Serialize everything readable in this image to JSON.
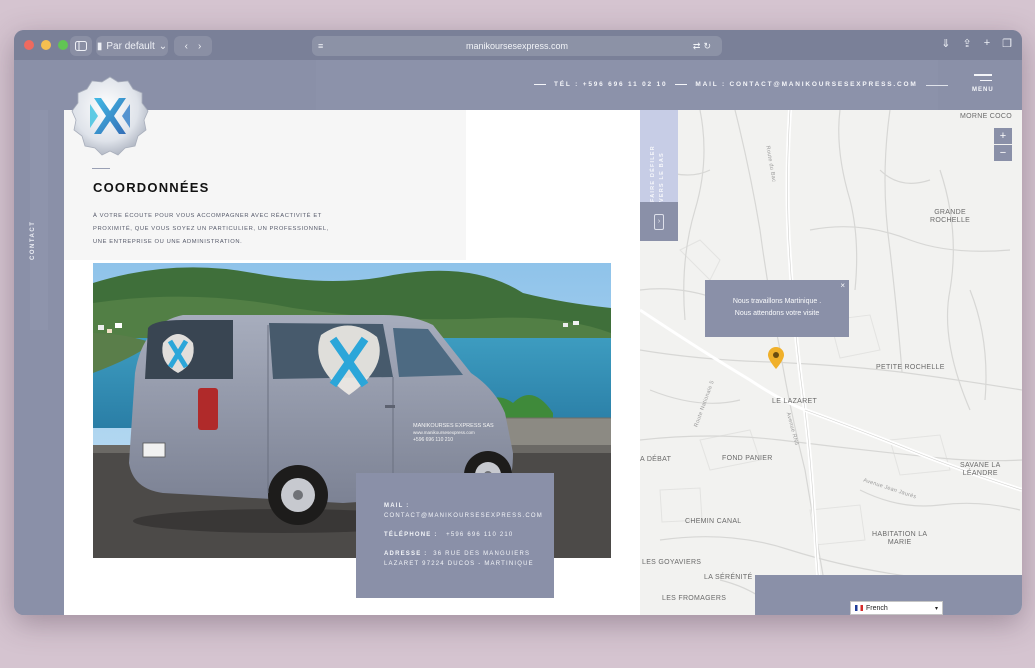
{
  "browser": {
    "profile": "Par default",
    "url": "manikoursesexpress.com"
  },
  "header": {
    "phone": "TÉL : +596 696 11 02 10",
    "mail": "MAIL : CONTACT@MANIKOURSESEXPRESS.COM",
    "menu_label": "MENU"
  },
  "sidebar": {
    "label": "CONTACT"
  },
  "contact_page": {
    "title": "COORDONNÉES",
    "intro": "À votre écoute pour vous accompagner avec réactivité et proximité, que vous soyez un particulier, un professionnel, une entreprise ou une administration.",
    "van_text_1": "MANIKOURSES EXPRESS SAS",
    "van_text_2": "www.manikoursesexpress.com",
    "van_text_3": "+596 696 110 210",
    "info": {
      "mail_label": "MAIL :",
      "mail_value": "CONTACT@MANIKOURSESEXPRESS.COM",
      "phone_label": "TÉLÉPHONE :",
      "phone_value": "+596 696 110 210",
      "address_label": "ADRESSE :",
      "address_value": "36 RUE DES MANGUIERS",
      "address_value_2": "LAZARET 97224 DUCOS - MARTINIQUE"
    }
  },
  "map": {
    "scroll_label": "FAIRE DÉFILER VERS LE BAS",
    "arrow": "›",
    "zoom_in": "+",
    "zoom_out": "−",
    "popup_line1": "Nous travaillons Martinique .",
    "popup_line2": "Nous attendons votre visite",
    "popup_close": "×",
    "places": {
      "morne_coco": "MORNE COCO",
      "grande_rochelle_1": "GRANDE",
      "grande_rochelle_2": "ROCHELLE",
      "petite_rochelle": "PETITE ROCHELLE",
      "le_lazaret": "LE LAZARET",
      "debat": "A DÉBAT",
      "fond_panier": "FOND PANIER",
      "savane_1": "SAVANE LA",
      "savane_2": "LÉANDRE",
      "chemin_canal": "CHEMIN CANAL",
      "les_goyaviers": "LES GOYAVIERS",
      "la_serenite": "LA SÉRÉNITÉ",
      "habitation_1": "HABITATION LA",
      "habitation_2": "MARIE",
      "les_fromagers": "LES FROMAGERS"
    },
    "roads": {
      "route_bac": "Route du Bac",
      "rn5": "Avenue RN5",
      "route_nationale": "Route Nationale 5",
      "jean_jaures": "Avenue Jean Jaurès"
    }
  },
  "language": {
    "selected": "French"
  },
  "colors": {
    "accent": "#8a90a8",
    "pin": "#f0b02a",
    "background": "#d5c4d0"
  }
}
